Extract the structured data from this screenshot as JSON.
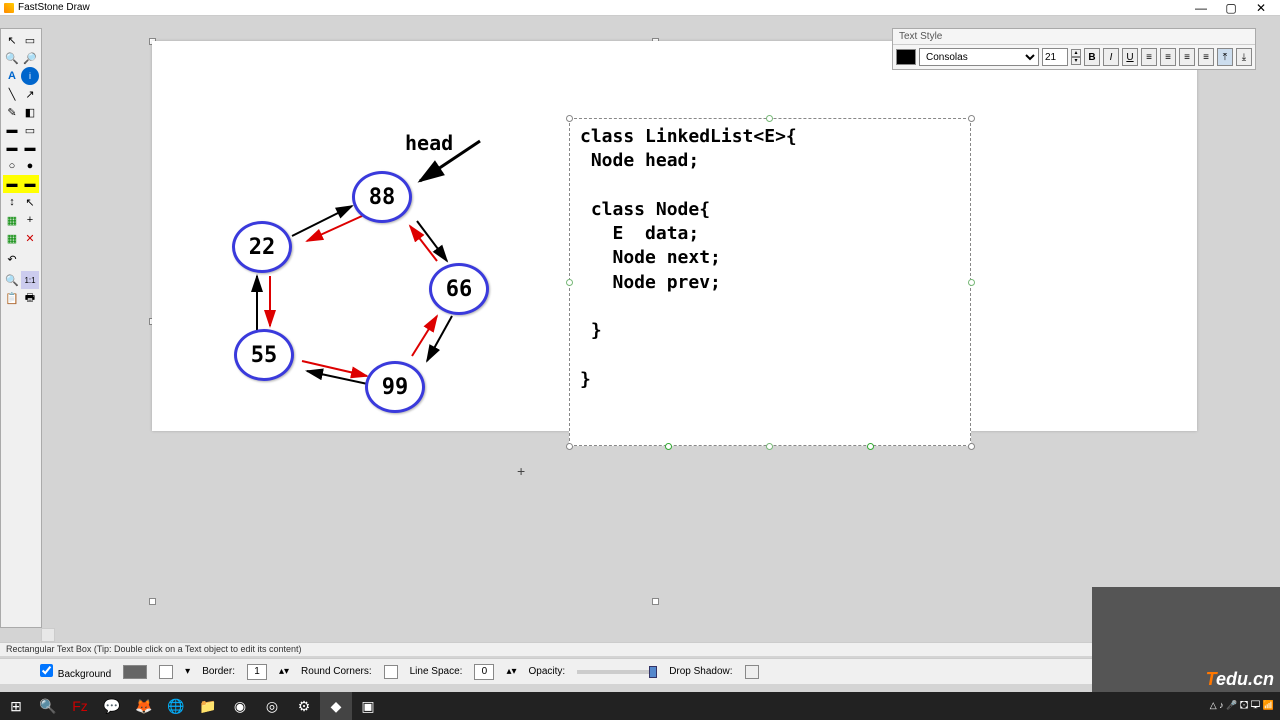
{
  "app": {
    "title": "FastStone Draw"
  },
  "window": {
    "min": "—",
    "max": "▢",
    "close": "✕"
  },
  "text_style": {
    "title": "Text Style",
    "font": "Consolas",
    "size": "21",
    "bold": "B",
    "italic": "I",
    "underline": "U"
  },
  "diagram": {
    "head_label": "head",
    "nodes": {
      "n1": "88",
      "n2": "22",
      "n3": "66",
      "n4": "55",
      "n5": "99"
    }
  },
  "code": "class LinkedList<E>{\n Node head;\n\n class Node{\n   E  data;\n   Node next;\n   Node prev;\n\n }\n\n}",
  "status": "Rectangular Text Box (Tip: Double click on a Text object to edit its content)",
  "props": {
    "background": "Background",
    "border": "Border:",
    "border_val": "1",
    "round": "Round Corners:",
    "linespace": "Line Space:",
    "linespace_val": "0",
    "opacity": "Opacity:",
    "shadow": "Drop Shadow:"
  },
  "tray": {
    "icons": "△ ♪ 🎤 🖸 🖵 📶"
  }
}
